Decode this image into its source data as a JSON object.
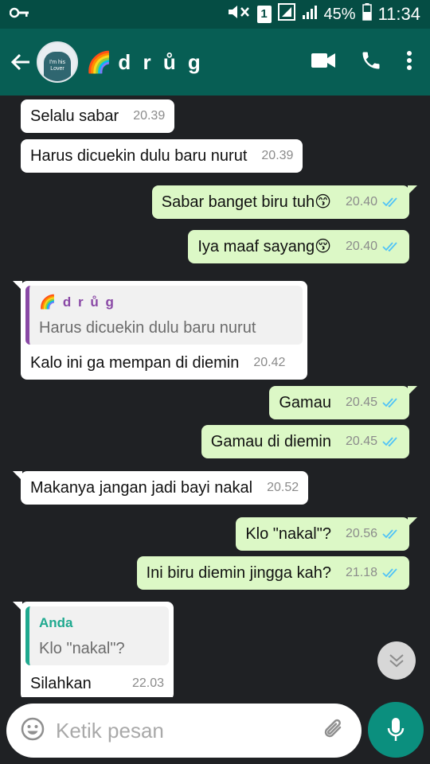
{
  "status_bar": {
    "battery_percent": "45%",
    "time": "11:34",
    "sim_label": "1"
  },
  "header": {
    "contact_name": "d r ů g",
    "contact_emoji": "🌈",
    "avatar_text": "I'm his Lover"
  },
  "messages": [
    {
      "dir": "in",
      "text": "Selalu sabar",
      "time": "20.39"
    },
    {
      "dir": "in",
      "text": "Harus dicuekin dulu baru nurut",
      "time": "20.39"
    },
    {
      "dir": "out",
      "text": "Sabar banget biru tuh😙",
      "time": "20.40"
    },
    {
      "dir": "out",
      "text": "Iya maaf sayang😚",
      "time": "20.40"
    },
    {
      "dir": "in",
      "quote_author": "🌈 d r ů g",
      "quote_text": "Harus dicuekin dulu baru nurut",
      "text": "Kalo ini ga mempan di diemin",
      "time": "20.42"
    },
    {
      "dir": "out",
      "text": "Gamau",
      "time": "20.45"
    },
    {
      "dir": "out",
      "text": "Gamau di diemin",
      "time": "20.45"
    },
    {
      "dir": "in",
      "text": "Makanya jangan jadi bayi nakal",
      "time": "20.52"
    },
    {
      "dir": "out",
      "text": "Klo \"nakal\"?",
      "time": "20.56"
    },
    {
      "dir": "out",
      "text": "Ini biru diemin jingga kah?",
      "time": "21.18"
    },
    {
      "dir": "in",
      "quote_author": "Anda",
      "quote_text": "Klo \"nakal\"?",
      "text": "Silahkan",
      "time": "22.03"
    }
  ],
  "composer": {
    "placeholder": "Ketik pesan"
  },
  "colors": {
    "header": "#075e54",
    "status_bar": "#054d44",
    "outgoing_bubble": "#dcf8c6",
    "incoming_bubble": "#ffffff",
    "read_ticks": "#4fc3f7",
    "mic_button": "#0b8f7e"
  }
}
